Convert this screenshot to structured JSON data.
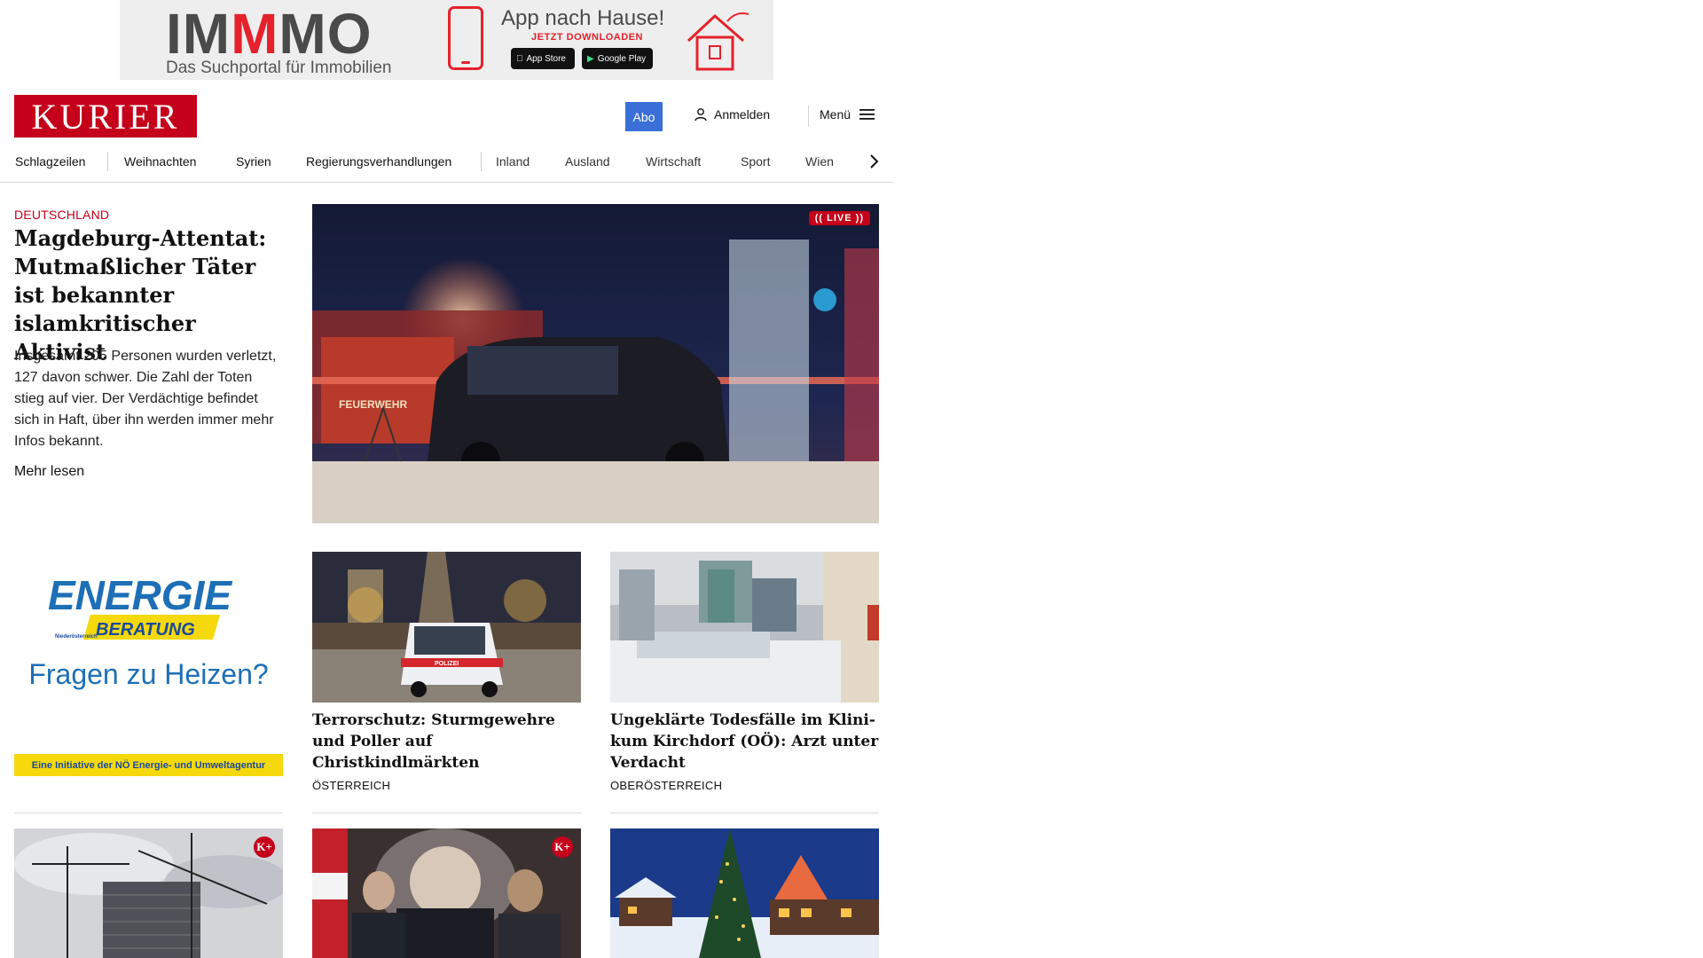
{
  "banner_ad": {
    "brand_part1": "IM",
    "brand_part2": "M",
    "brand_part3": "MO",
    "tagline": "Das Suchportal für Immobilien",
    "title": "App nach Hause!",
    "cta": "JETZT DOWNLOADEN",
    "app_store": "App Store",
    "google_play": "Google Play"
  },
  "header": {
    "logo": "KURIER",
    "abo": "Abo",
    "login": "Anmelden",
    "menu": "Menü"
  },
  "nav": {
    "items": [
      "Schlagzeilen",
      "Weihnachten",
      "Syrien",
      "Regierungsverhandlungen",
      "Inland",
      "Ausland",
      "Wirtschaft",
      "Sport",
      "Wien"
    ]
  },
  "lead": {
    "kicker": "DEUTSCHLAND",
    "title": "Magdeburg-Attentat: Mutmaßlicher Täter ist bekannter islamkriti­scher Aktivist",
    "teaser": "Insgesamt 205 Personen wurden verletzt, 127 davon schwer. Die Zahl der Toten stieg auf vier. Der Verdächtige befindet sich in Haft, über ihn werden immer mehr Infos bekannt.",
    "more": "Mehr lesen",
    "live_badge": "LIVE",
    "image_text": "FEUERWEHR"
  },
  "ad_energie": {
    "logo": "ENERGIE",
    "logo_sub": "BERATUNG",
    "logo_small": "Niederösterreich",
    "headline": "Fragen zu Heizen?",
    "footer": "Eine Initiative der NÖ Energie- und Umweltagentur"
  },
  "cards": [
    {
      "title": "Terrorschutz: Sturmgewehre und Poller auf Christkindlmärkten",
      "kicker": "ÖSTERREICH",
      "image_text": "POLIZEI"
    },
    {
      "title": "Ungeklärte Todesfälle im Klini­kum Kirchdorf (OÖ): Arzt unter Verdacht",
      "kicker": "OBERÖSTERREICH"
    }
  ],
  "bottom": {
    "kplus": "K+"
  },
  "colors": {
    "brand_red": "#c4001a",
    "abo_blue": "#3a6fd8",
    "ad_blue": "#1d6fb6",
    "ad_yellow": "#f5d90c"
  }
}
